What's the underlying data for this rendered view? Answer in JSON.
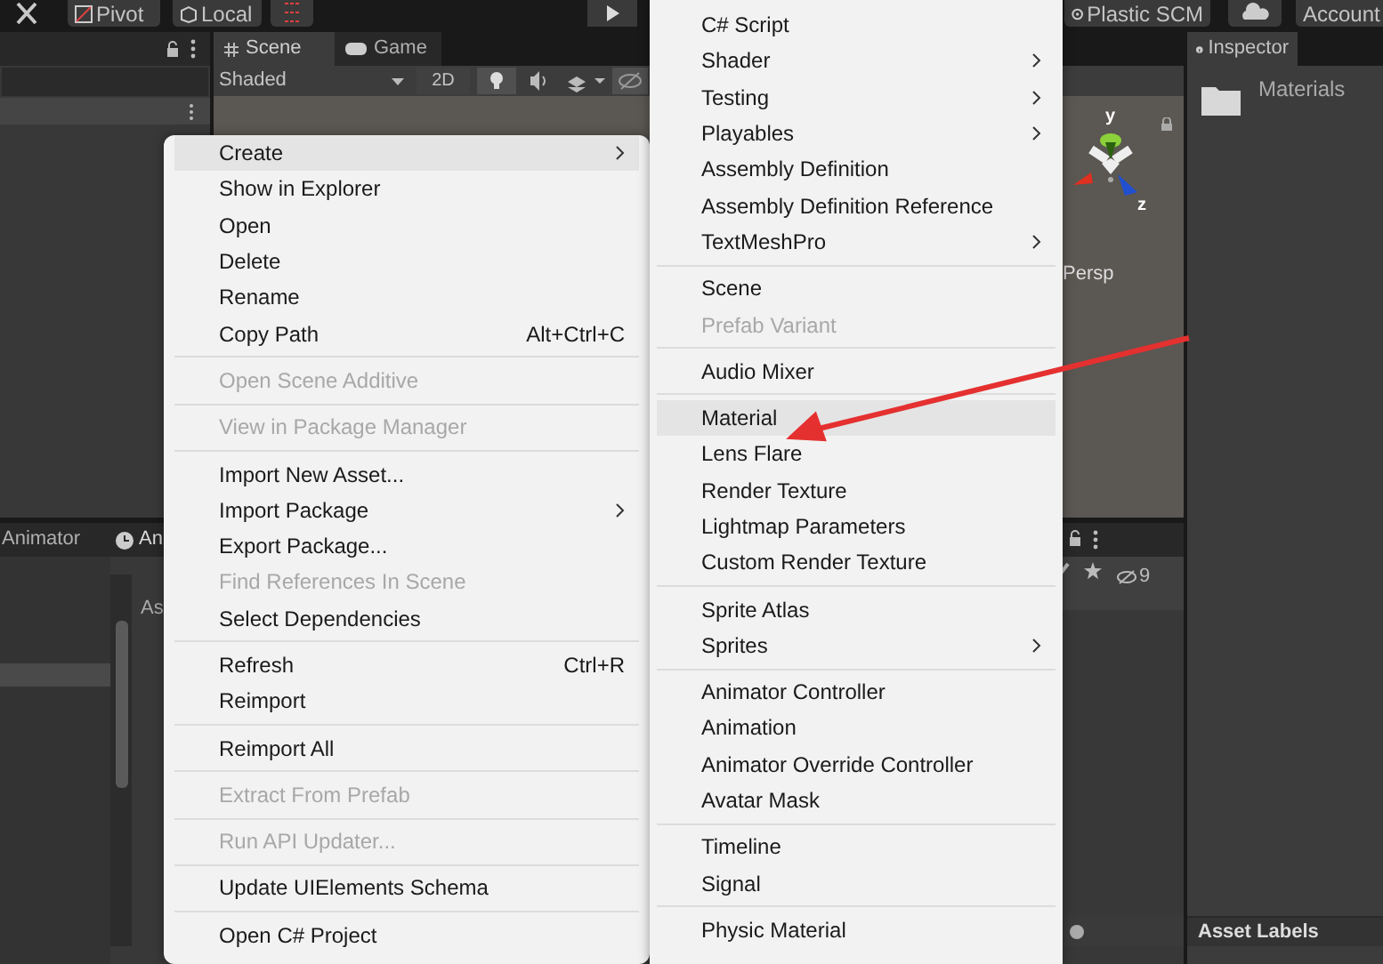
{
  "toolbar": {
    "pivot": "Pivot",
    "local": "Local",
    "plastic": "Plastic SCM",
    "account": "Account"
  },
  "scene_tabs": [
    {
      "label": "Scene",
      "selected": true
    },
    {
      "label": "Game",
      "selected": false
    }
  ],
  "scene_toolbar": {
    "shading": "Shaded",
    "mode_2d": "2D"
  },
  "gizmo": {
    "y_label": "y",
    "z_label": "z",
    "projection": "Persp"
  },
  "inspector": {
    "tab": "Inspector",
    "asset_name": "Materials",
    "footer": "Asset Labels"
  },
  "bottom_tabs": [
    {
      "label": "Animator",
      "selected": false
    },
    {
      "label": "An",
      "selected": true
    }
  ],
  "project": {
    "column_header": "As",
    "hidden_count": "9"
  },
  "context_menu": {
    "items": [
      {
        "kind": "item",
        "label": "Create",
        "submenu": true,
        "disabled": false,
        "selected": true
      },
      {
        "kind": "item",
        "label": "Show in Explorer",
        "submenu": false,
        "disabled": false,
        "selected": false
      },
      {
        "kind": "item",
        "label": "Open",
        "submenu": false,
        "disabled": false,
        "selected": false
      },
      {
        "kind": "item",
        "label": "Delete",
        "submenu": false,
        "disabled": false,
        "selected": false
      },
      {
        "kind": "item",
        "label": "Rename",
        "submenu": false,
        "disabled": false,
        "selected": false
      },
      {
        "kind": "item",
        "label": "Copy Path",
        "shortcut": "Alt+Ctrl+C",
        "submenu": false,
        "disabled": false,
        "selected": false
      },
      {
        "kind": "separator"
      },
      {
        "kind": "item",
        "label": "Open Scene Additive",
        "submenu": false,
        "disabled": true,
        "selected": false
      },
      {
        "kind": "separator"
      },
      {
        "kind": "item",
        "label": "View in Package Manager",
        "submenu": false,
        "disabled": true,
        "selected": false
      },
      {
        "kind": "separator"
      },
      {
        "kind": "item",
        "label": "Import New Asset...",
        "submenu": false,
        "disabled": false,
        "selected": false
      },
      {
        "kind": "item",
        "label": "Import Package",
        "submenu": true,
        "disabled": false,
        "selected": false
      },
      {
        "kind": "item",
        "label": "Export Package...",
        "submenu": false,
        "disabled": false,
        "selected": false
      },
      {
        "kind": "item",
        "label": "Find References In Scene",
        "submenu": false,
        "disabled": true,
        "selected": false
      },
      {
        "kind": "item",
        "label": "Select Dependencies",
        "submenu": false,
        "disabled": false,
        "selected": false
      },
      {
        "kind": "separator"
      },
      {
        "kind": "item",
        "label": "Refresh",
        "shortcut": "Ctrl+R",
        "submenu": false,
        "disabled": false,
        "selected": false
      },
      {
        "kind": "item",
        "label": "Reimport",
        "submenu": false,
        "disabled": false,
        "selected": false
      },
      {
        "kind": "separator"
      },
      {
        "kind": "item",
        "label": "Reimport All",
        "submenu": false,
        "disabled": false,
        "selected": false
      },
      {
        "kind": "separator"
      },
      {
        "kind": "item",
        "label": "Extract From Prefab",
        "submenu": false,
        "disabled": true,
        "selected": false
      },
      {
        "kind": "separator"
      },
      {
        "kind": "item",
        "label": "Run API Updater...",
        "submenu": false,
        "disabled": true,
        "selected": false
      },
      {
        "kind": "separator"
      },
      {
        "kind": "item",
        "label": "Update UIElements Schema",
        "submenu": false,
        "disabled": false,
        "selected": false
      },
      {
        "kind": "separator"
      },
      {
        "kind": "item",
        "label": "Open C# Project",
        "submenu": false,
        "disabled": false,
        "selected": false
      }
    ]
  },
  "create_submenu": {
    "items": [
      {
        "kind": "item",
        "label": "C# Script",
        "submenu": false,
        "disabled": false,
        "selected": false
      },
      {
        "kind": "item",
        "label": "Shader",
        "submenu": true,
        "disabled": false,
        "selected": false
      },
      {
        "kind": "item",
        "label": "Testing",
        "submenu": true,
        "disabled": false,
        "selected": false
      },
      {
        "kind": "item",
        "label": "Playables",
        "submenu": true,
        "disabled": false,
        "selected": false
      },
      {
        "kind": "item",
        "label": "Assembly Definition",
        "submenu": false,
        "disabled": false,
        "selected": false
      },
      {
        "kind": "item",
        "label": "Assembly Definition Reference",
        "submenu": false,
        "disabled": false,
        "selected": false
      },
      {
        "kind": "item",
        "label": "TextMeshPro",
        "submenu": true,
        "disabled": false,
        "selected": false
      },
      {
        "kind": "separator"
      },
      {
        "kind": "item",
        "label": "Scene",
        "submenu": false,
        "disabled": false,
        "selected": false
      },
      {
        "kind": "item",
        "label": "Prefab Variant",
        "submenu": false,
        "disabled": true,
        "selected": false
      },
      {
        "kind": "separator"
      },
      {
        "kind": "item",
        "label": "Audio Mixer",
        "submenu": false,
        "disabled": false,
        "selected": false
      },
      {
        "kind": "separator"
      },
      {
        "kind": "item",
        "label": "Material",
        "submenu": false,
        "disabled": false,
        "selected": true
      },
      {
        "kind": "item",
        "label": "Lens Flare",
        "submenu": false,
        "disabled": false,
        "selected": false
      },
      {
        "kind": "item",
        "label": "Render Texture",
        "submenu": false,
        "disabled": false,
        "selected": false
      },
      {
        "kind": "item",
        "label": "Lightmap Parameters",
        "submenu": false,
        "disabled": false,
        "selected": false
      },
      {
        "kind": "item",
        "label": "Custom Render Texture",
        "submenu": false,
        "disabled": false,
        "selected": false
      },
      {
        "kind": "separator"
      },
      {
        "kind": "item",
        "label": "Sprite Atlas",
        "submenu": false,
        "disabled": false,
        "selected": false
      },
      {
        "kind": "item",
        "label": "Sprites",
        "submenu": true,
        "disabled": false,
        "selected": false
      },
      {
        "kind": "separator"
      },
      {
        "kind": "item",
        "label": "Animator Controller",
        "submenu": false,
        "disabled": false,
        "selected": false
      },
      {
        "kind": "item",
        "label": "Animation",
        "submenu": false,
        "disabled": false,
        "selected": false
      },
      {
        "kind": "item",
        "label": "Animator Override Controller",
        "submenu": false,
        "disabled": false,
        "selected": false
      },
      {
        "kind": "item",
        "label": "Avatar Mask",
        "submenu": false,
        "disabled": false,
        "selected": false
      },
      {
        "kind": "separator"
      },
      {
        "kind": "item",
        "label": "Timeline",
        "submenu": false,
        "disabled": false,
        "selected": false
      },
      {
        "kind": "item",
        "label": "Signal",
        "submenu": false,
        "disabled": false,
        "selected": false
      },
      {
        "kind": "separator"
      },
      {
        "kind": "item",
        "label": "Physic Material",
        "submenu": false,
        "disabled": false,
        "selected": false
      }
    ]
  }
}
